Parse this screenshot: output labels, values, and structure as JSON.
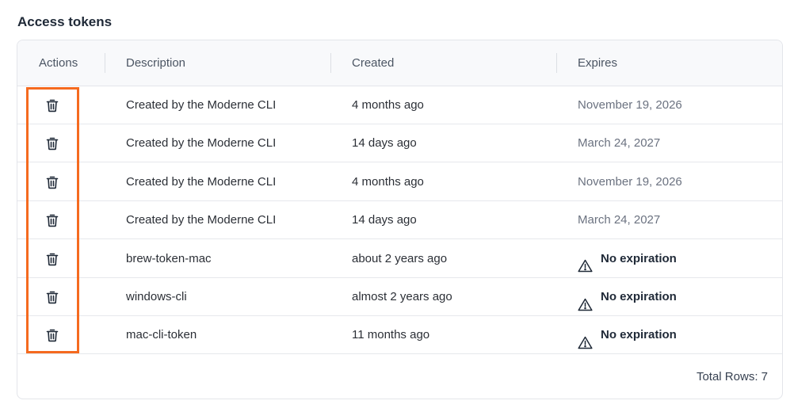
{
  "section": {
    "title": "Access tokens"
  },
  "table": {
    "headers": {
      "actions": "Actions",
      "description": "Description",
      "created": "Created",
      "expires": "Expires"
    },
    "rows": [
      {
        "description": "Created by the Moderne CLI",
        "created": "4 months ago",
        "expires": "November 19, 2026",
        "no_expiration": false
      },
      {
        "description": "Created by the Moderne CLI",
        "created": "14 days ago",
        "expires": "March 24, 2027",
        "no_expiration": false
      },
      {
        "description": "Created by the Moderne CLI",
        "created": "4 months ago",
        "expires": "November 19, 2026",
        "no_expiration": false
      },
      {
        "description": "Created by the Moderne CLI",
        "created": "14 days ago",
        "expires": "March 24, 2027",
        "no_expiration": false
      },
      {
        "description": "brew-token-mac",
        "created": "about 2 years ago",
        "expires": "No expiration",
        "no_expiration": true
      },
      {
        "description": "windows-cli",
        "created": "almost 2 years ago",
        "expires": "No expiration",
        "no_expiration": true
      },
      {
        "description": "mac-cli-token",
        "created": "11 months ago",
        "expires": "No expiration",
        "no_expiration": true
      }
    ],
    "action_icon": "trash-icon",
    "warning_icon": "warning-triangle-icon",
    "footer": {
      "total_rows": "Total Rows: 7"
    }
  },
  "colors": {
    "highlight": "#f56a1f",
    "header_bg": "#f8f9fb",
    "border": "#e3e5ea"
  }
}
